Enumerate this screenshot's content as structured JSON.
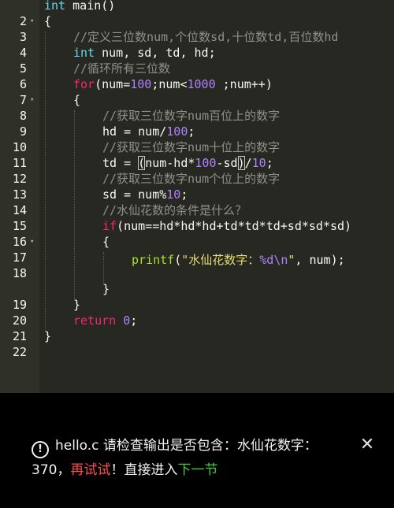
{
  "editor": {
    "lines": [
      {
        "n": "2",
        "fold": ""
      },
      {
        "n": "3",
        "fold": "▾"
      },
      {
        "n": "4",
        "fold": ""
      },
      {
        "n": "5",
        "fold": ""
      },
      {
        "n": "6",
        "fold": ""
      },
      {
        "n": "7",
        "fold": ""
      },
      {
        "n": "8",
        "fold": "▾"
      },
      {
        "n": "9",
        "fold": ""
      },
      {
        "n": "10",
        "fold": ""
      },
      {
        "n": "11",
        "fold": ""
      },
      {
        "n": "12",
        "fold": ""
      },
      {
        "n": "13",
        "fold": ""
      },
      {
        "n": "14",
        "fold": ""
      },
      {
        "n": "15",
        "fold": ""
      },
      {
        "n": "16",
        "fold": ""
      },
      {
        "n": "17",
        "fold": "▾"
      },
      {
        "n": "18",
        "fold": ""
      },
      {
        "n": "19",
        "fold": ""
      },
      {
        "n": "20",
        "fold": ""
      },
      {
        "n": "21",
        "fold": ""
      },
      {
        "n": "22",
        "fold": ""
      }
    ],
    "code": {
      "l2_type": "int",
      "l2_rest": " main()",
      "l3": "{",
      "l4_comment": "//定义三位数num,个位数sd,十位数td,百位数hd",
      "l5_type": "int",
      "l5_rest": " num, sd, td, hd;",
      "l6_comment": "//循环所有三位数",
      "l7_kw": "for",
      "l7_a": "(num=",
      "l7_n1": "100",
      "l7_b": ";num<",
      "l7_n2": "1000",
      "l7_c": " ;num++)",
      "l8": "{",
      "l9_comment": "//获取三位数字num百位上的数字",
      "l10_a": "hd = num/",
      "l10_n": "100",
      "l10_b": ";",
      "l11_comment": "//获取三位数字num十位上的数字",
      "l12_a": "td = ",
      "l12_p1": "(",
      "l12_b": "num-hd*",
      "l12_n1": "100",
      "l12_c": "-sd",
      "l12_p2": ")",
      "l12_d": "/",
      "l12_n2": "10",
      "l12_e": ";",
      "l13_comment": "//获取三位数字num个位上的数字",
      "l14_a": "sd = num%",
      "l14_n": "10",
      "l14_b": ";",
      "l15_comment": "//水仙花数的条件是什么？",
      "l16_kw": "if",
      "l16_rest": "(num==hd*hd*hd+td*td*td+sd*sd*sd)",
      "l17": "{",
      "l18_fn": "printf",
      "l18_a": "(",
      "l18_str1": "\"水仙花数字：",
      "l18_fmt": "%d\\n",
      "l18_str2": "\"",
      "l18_b": ", num);",
      "l19": "}",
      "l20": "}",
      "l21_kw": "return",
      "l21_sp": " ",
      "l21_n": "0",
      "l21_b": ";",
      "l22": "}"
    }
  },
  "toast": {
    "icon": "!",
    "icon_name": "info-circle-icon",
    "part1": "hello.c 请检查输出是否包含：水仙花数字：370，",
    "retry": "再试试",
    "part2": "！直接进入",
    "next": "下一节",
    "close": "✕",
    "colors": {
      "retry": "#ff4d4d",
      "next": "#3ec93e"
    }
  }
}
